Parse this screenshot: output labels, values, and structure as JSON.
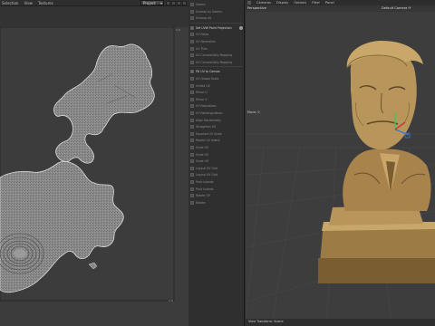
{
  "uv_editor": {
    "menu": [
      "Selection",
      "View",
      "Textures"
    ],
    "dropdown_value": "Project",
    "corner_labels": {
      "top": "1.0",
      "bottom": "1.0"
    }
  },
  "tools": {
    "items": [
      {
        "label": "Seams",
        "bright": false
      },
      {
        "label": "Unwrap by Seams",
        "bright": false
      },
      {
        "label": "Unwrap All",
        "bright": false
      },
      {
        "label": "Set UVW Point Projection",
        "bright": true,
        "help": true
      },
      {
        "label": "UV Relax",
        "bright": false
      },
      {
        "label": "UV Normalize",
        "bright": false
      },
      {
        "label": "UV Tiles",
        "bright": false
      },
      {
        "label": "UV Connectivity Mapping",
        "bright": false
      },
      {
        "label": "UV Connectivity Mapping",
        "bright": false
      },
      {
        "label": "Fill UV to Canvas",
        "bright": true
      },
      {
        "label": "UV Global Scale",
        "bright": false
      },
      {
        "label": "Unfold UV",
        "bright": false
      },
      {
        "label": "Mirror U",
        "bright": false
      },
      {
        "label": "Mirror V",
        "bright": false
      },
      {
        "label": "UV Regulation",
        "bright": false
      },
      {
        "label": "UV Rectangulation",
        "bright": false
      },
      {
        "label": "Align Horizontally",
        "bright": false
      },
      {
        "label": "Straighten UV",
        "bright": false
      },
      {
        "label": "Equalize UV Scale",
        "bright": false
      },
      {
        "label": "Rotate UV Island",
        "bright": false
      },
      {
        "label": "Scale UV",
        "bright": false
      },
      {
        "label": "Scale UV",
        "bright": false
      },
      {
        "label": "Scale UV",
        "bright": false
      },
      {
        "label": "Layout UV Grid",
        "bright": false
      },
      {
        "label": "Layout UV Grid",
        "bright": false
      },
      {
        "label": "Pack Islands",
        "bright": false
      },
      {
        "label": "Pack Islands",
        "bright": false
      },
      {
        "label": "Rotate UV",
        "bright": false
      },
      {
        "label": "Rotate",
        "bright": false
      }
    ]
  },
  "viewport": {
    "menu": [
      "Cameras",
      "Display",
      "Options",
      "Filter",
      "Panel"
    ],
    "perspective_label": "Perspective",
    "camera_label": "Default Camera ⟳",
    "move_label": "Move: 0",
    "transform_label": "View Transform: Scene",
    "colors": {
      "bust": "#b8955a",
      "bust_dark": "#7a5e32",
      "grid": "#4a4a4a",
      "axis_red": "#c83a3a",
      "axis_green": "#3ac85a",
      "axis_blue": "#3a7ad8"
    }
  }
}
